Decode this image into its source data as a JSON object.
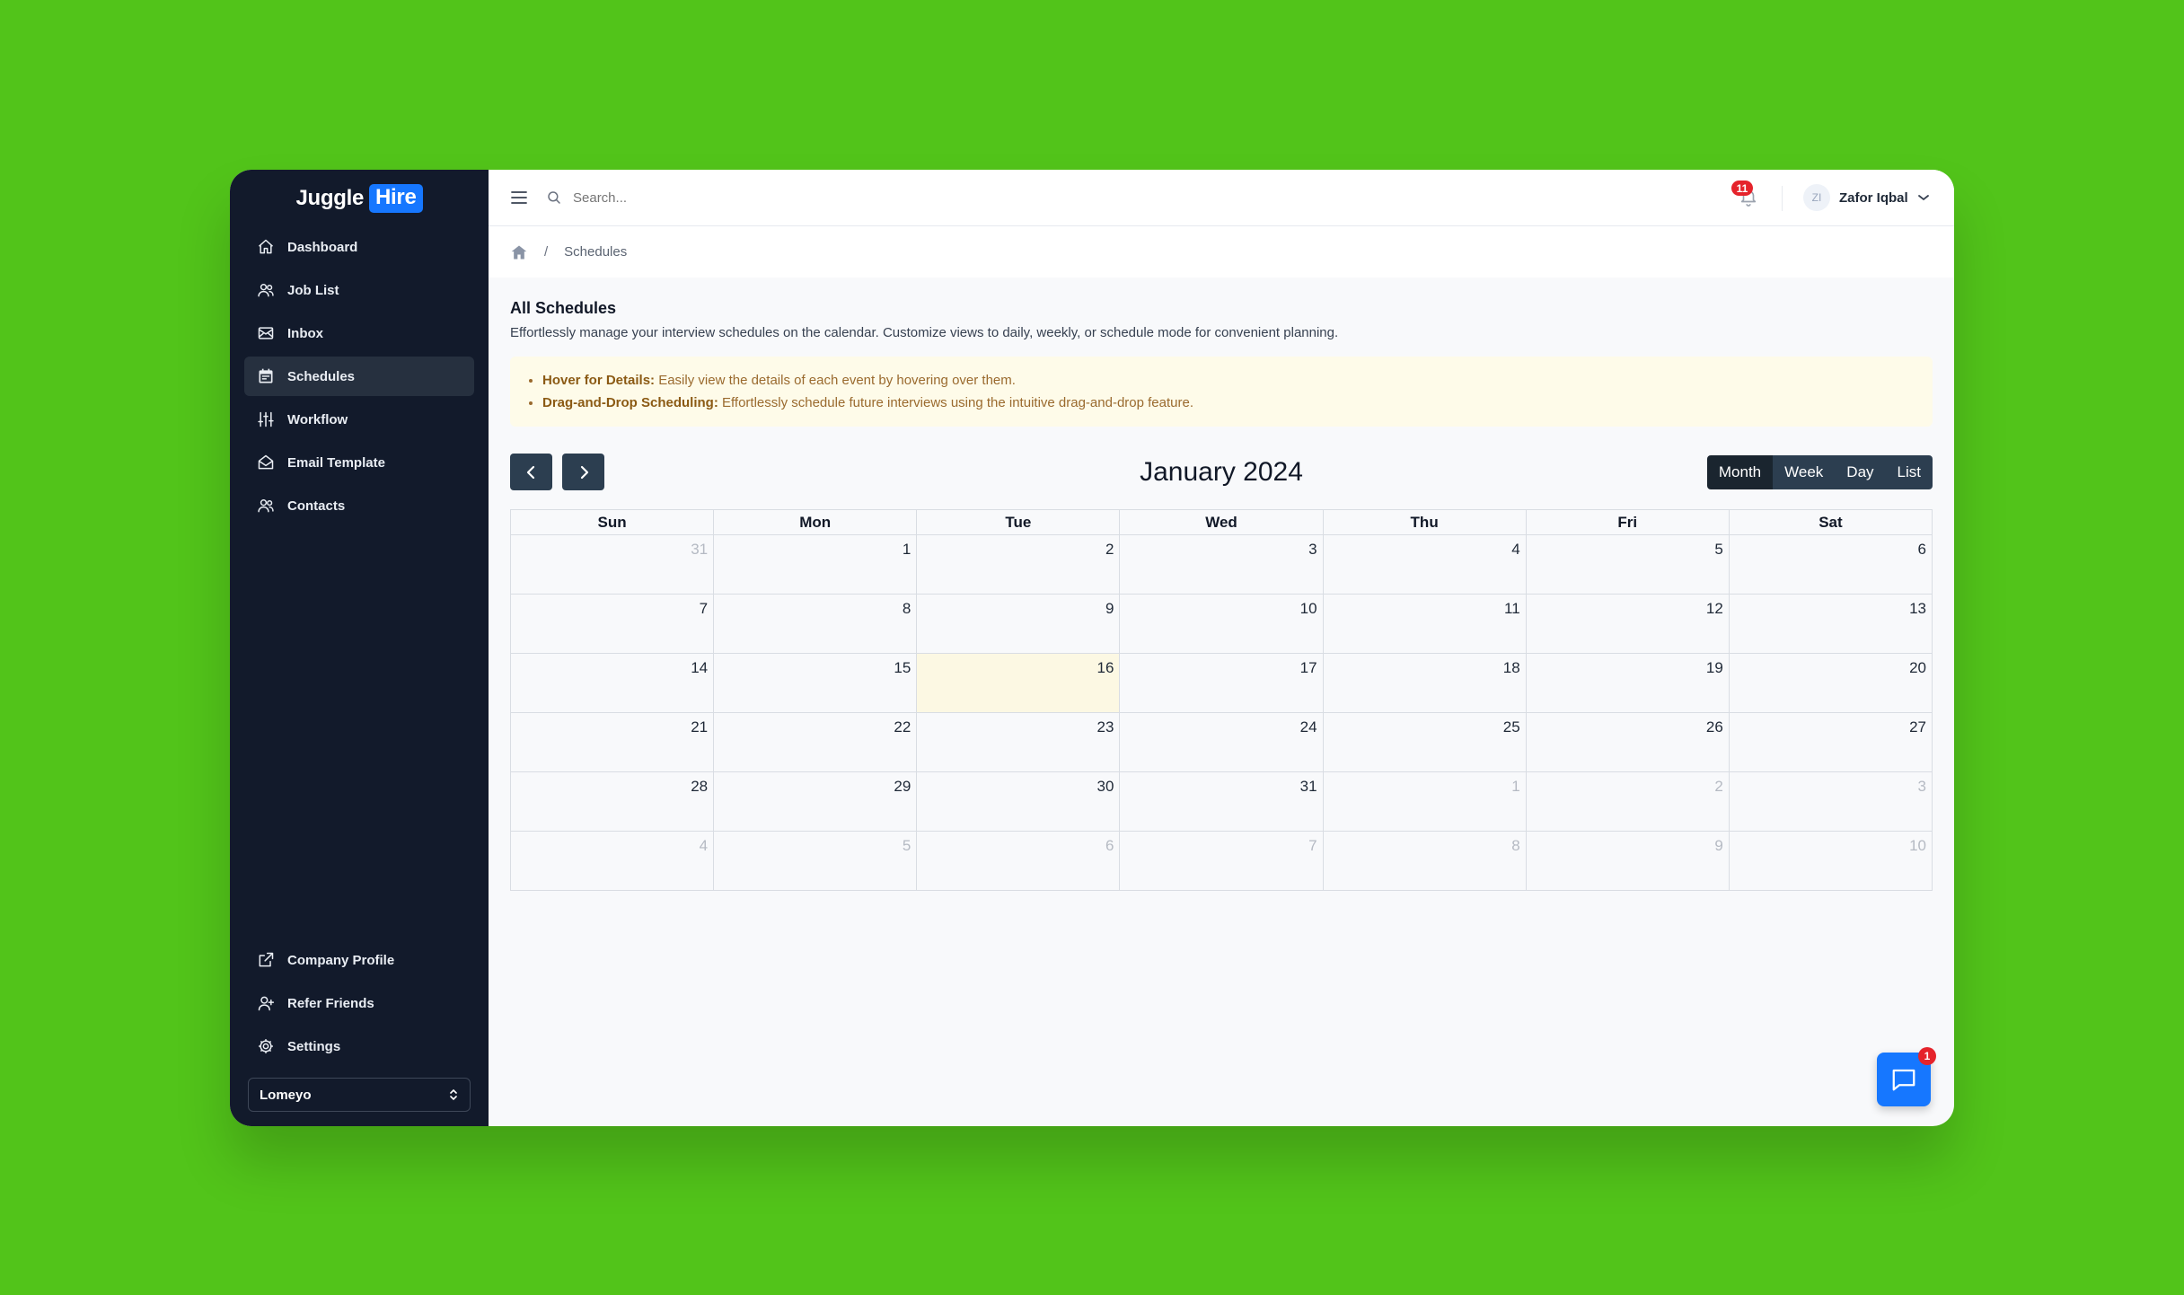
{
  "brand": {
    "part1": "Juggle",
    "part2": "Hire"
  },
  "sidebar": {
    "items": [
      {
        "label": "Dashboard",
        "icon": "home-icon"
      },
      {
        "label": "Job List",
        "icon": "users-icon"
      },
      {
        "label": "Inbox",
        "icon": "mail-icon"
      },
      {
        "label": "Schedules",
        "icon": "calendar-icon",
        "active": true
      },
      {
        "label": "Workflow",
        "icon": "sliders-icon"
      },
      {
        "label": "Email Template",
        "icon": "mail-open-icon"
      },
      {
        "label": "Contacts",
        "icon": "users-icon"
      }
    ],
    "bottom_items": [
      {
        "label": "Company Profile",
        "icon": "external-link-icon"
      },
      {
        "label": "Refer Friends",
        "icon": "user-plus-icon"
      },
      {
        "label": "Settings",
        "icon": "gear-icon"
      }
    ],
    "org_select": "Lomeyo"
  },
  "topbar": {
    "search_placeholder": "Search...",
    "notification_count": "11",
    "user_initials": "ZI",
    "user_name": "Zafor Iqbal"
  },
  "breadcrumb": {
    "current": "Schedules"
  },
  "page": {
    "title": "All Schedules",
    "description": "Effortlessly manage your interview schedules on the calendar. Customize views to daily, weekly, or schedule mode for convenient planning.",
    "tips": [
      {
        "title": "Hover for Details:",
        "text": " Easily view the details of each event by hovering over them."
      },
      {
        "title": "Drag-and-Drop Scheduling:",
        "text": " Effortlessly schedule future interviews using the intuitive drag-and-drop feature."
      }
    ]
  },
  "calendar": {
    "title": "January 2024",
    "views": [
      "Month",
      "Week",
      "Day",
      "List"
    ],
    "active_view": "Month",
    "weekdays": [
      "Sun",
      "Mon",
      "Tue",
      "Wed",
      "Thu",
      "Fri",
      "Sat"
    ],
    "weeks": [
      [
        "31",
        "1",
        "2",
        "3",
        "4",
        "5",
        "6"
      ],
      [
        "7",
        "8",
        "9",
        "10",
        "11",
        "12",
        "13"
      ],
      [
        "14",
        "15",
        "16",
        "17",
        "18",
        "19",
        "20"
      ],
      [
        "21",
        "22",
        "23",
        "24",
        "25",
        "26",
        "27"
      ],
      [
        "28",
        "29",
        "30",
        "31",
        "1",
        "2",
        "3"
      ],
      [
        "4",
        "5",
        "6",
        "7",
        "8",
        "9",
        "10"
      ]
    ],
    "today": "16"
  },
  "chat": {
    "badge": "1"
  },
  "colors": {
    "background": "#52c41a",
    "sidebar": "#121a2b",
    "brand_blue": "#1677ff",
    "button_dark": "#2c3e50",
    "today_highlight": "#fcf8e3"
  }
}
